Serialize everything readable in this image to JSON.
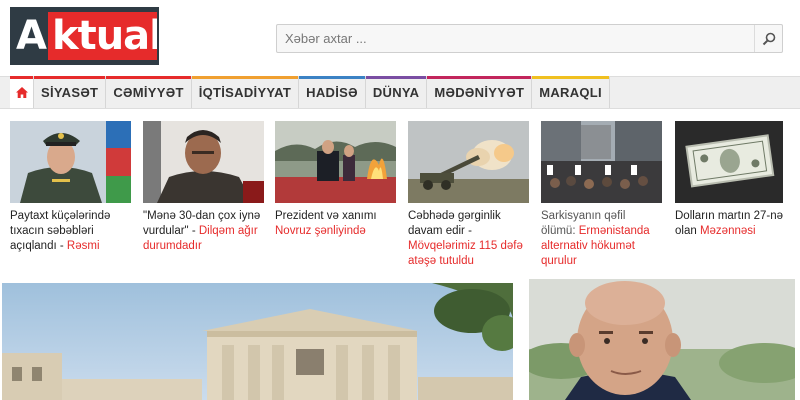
{
  "header": {
    "logo_text": "Aktual",
    "search": {
      "placeholder": "Xəbər axtar ..."
    }
  },
  "nav": {
    "items": [
      {
        "label": "SİYASƏT",
        "color": "#e62b2b"
      },
      {
        "label": "CƏMİYYƏT",
        "color": "#e62b2b"
      },
      {
        "label": "İQTİSADİYYAT",
        "color": "#f0a030"
      },
      {
        "label": "HADİSƏ",
        "color": "#3b82c4"
      },
      {
        "label": "DÜNYA",
        "color": "#7a4ea3"
      },
      {
        "label": "MƏDƏNİYYƏT",
        "color": "#c2255c"
      },
      {
        "label": "MARAQLI",
        "color": "#f0c020"
      }
    ]
  },
  "news": [
    {
      "title": "Paytaxt küçələrində tıxacın səbəbləri açıqlandı",
      "sep": " - ",
      "category": "Rəsmi"
    },
    {
      "title": "\"Mənə 30-dan çox iynə vurdular\"",
      "sep": " - ",
      "category": "Dilqəm ağır durumdadır"
    },
    {
      "title": "Prezident və xanımı",
      "sep": " ",
      "category": "Novruz şənliyində"
    },
    {
      "title": "Cəbhədə gərginlik davam edir",
      "sep": " - ",
      "category": "Mövqelərimiz 115 dəfə atəşə tutuldu"
    },
    {
      "title": "Sarkisyanın qəfil ölümü:",
      "sep": " ",
      "category": "Ermənistanda alternativ hökumət qurulur"
    },
    {
      "title": "Dolların martın 27-nə olan",
      "sep": " ",
      "category": "Məzənnəsi"
    }
  ],
  "colors": {
    "accent": "#e62b2b",
    "nav_bg": "#efefef",
    "logo_dark": "#2f3b44"
  },
  "icons": {
    "home": "home-icon",
    "search": "search-icon"
  }
}
